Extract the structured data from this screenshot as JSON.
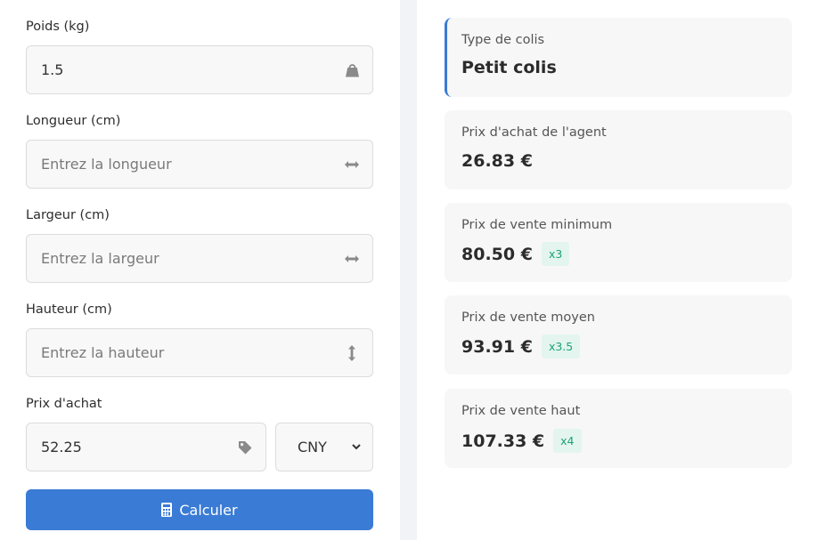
{
  "form": {
    "weight": {
      "label": "Poids (kg)",
      "value": "1.5",
      "placeholder": ""
    },
    "length": {
      "label": "Longueur (cm)",
      "value": "",
      "placeholder": "Entrez la longueur"
    },
    "width": {
      "label": "Largeur (cm)",
      "value": "",
      "placeholder": "Entrez la largeur"
    },
    "height": {
      "label": "Hauteur (cm)",
      "value": "",
      "placeholder": "Entrez la hauteur"
    },
    "purchase_price": {
      "label": "Prix d'achat",
      "value": "52.25",
      "placeholder": ""
    },
    "currency": {
      "selected": "CNY"
    },
    "submit_label": "Calculer"
  },
  "results": {
    "package_type": {
      "label": "Type de colis",
      "value": "Petit colis"
    },
    "agent_price": {
      "label": "Prix d'achat de l'agent",
      "value": "26.83 €"
    },
    "min_price": {
      "label": "Prix de vente minimum",
      "value": "80.50 €",
      "multiplier": "x3"
    },
    "avg_price": {
      "label": "Prix de vente moyen",
      "value": "93.91 €",
      "multiplier": "x3.5"
    },
    "high_price": {
      "label": "Prix de vente haut",
      "value": "107.33 €",
      "multiplier": "x4"
    }
  },
  "colors": {
    "accent": "#3a7bd5",
    "badge_text": "#1aa37a",
    "badge_bg": "#e3f5ee"
  }
}
